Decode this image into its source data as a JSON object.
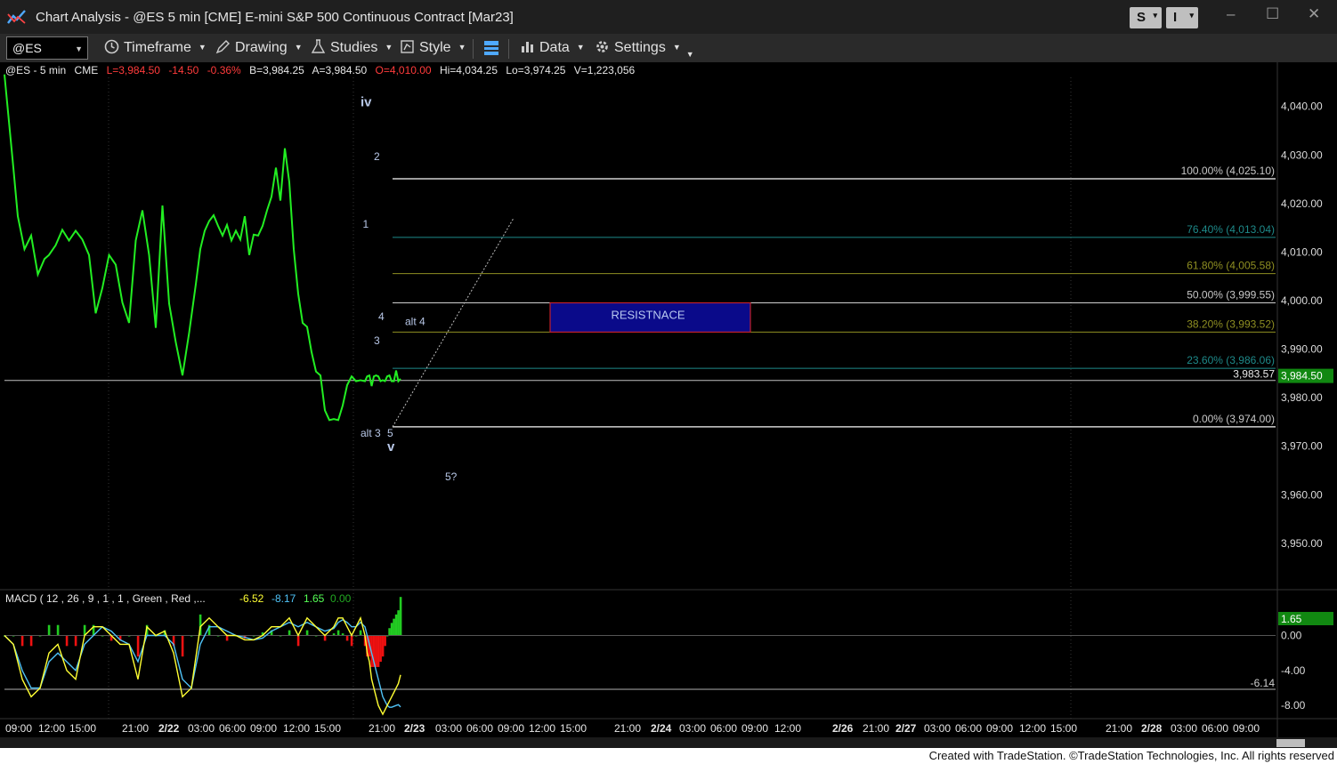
{
  "window": {
    "title": "Chart Analysis - @ES 5 min [CME] E-mini S&P 500 Continuous Contract [Mar23]",
    "btn_s": "S",
    "btn_i": "I",
    "minimize": "–",
    "maximize": "☐",
    "close": "✕"
  },
  "toolbar": {
    "symbol": "@ES",
    "timeframe": "Timeframe",
    "drawing": "Drawing",
    "studies": "Studies",
    "style": "Style",
    "data": "Data",
    "settings": "Settings"
  },
  "quote": {
    "symbol": "@ES - 5 min",
    "exchange": "CME",
    "last": "L=3,984.50",
    "change": "-14.50",
    "pct": "-0.36%",
    "bid": "B=3,984.25",
    "ask": "A=3,984.50",
    "open": "O=4,010.00",
    "high": "Hi=4,034.25",
    "low": "Lo=3,974.25",
    "volume": "V=1,223,056"
  },
  "colors": {
    "price": "#22ee22",
    "up": "#22cc22",
    "down": "#ee1111",
    "macd": "#4fc3f7",
    "signal": "#ffff33",
    "fib_white": "#d0d0d0",
    "fib_teal": "#1e8a8a",
    "fib_olive": "#8f8f22",
    "resistance_fill": "#0a0a8a",
    "resistance_border": "#c0202a",
    "label": "#b8c8e8",
    "last_price_bg": "#118811"
  },
  "chart_data": {
    "type": "line",
    "title": "",
    "xlabel": "",
    "ylabel": "",
    "ylim": [
      3941,
      4046
    ],
    "x_ticks": [
      "09:00",
      "12:00",
      "15:00",
      "21:00",
      "2/22",
      "03:00",
      "06:00",
      "09:00",
      "12:00",
      "15:00",
      "21:00",
      "2/23",
      "03:00",
      "06:00",
      "09:00",
      "12:00",
      "15:00",
      "21:00",
      "2/24",
      "03:00",
      "06:00",
      "09:00",
      "12:00",
      "2/26",
      "21:00",
      "2/27",
      "03:00",
      "06:00",
      "09:00",
      "12:00",
      "15:00",
      "21:00",
      "2/28",
      "03:00",
      "06:00",
      "09:00"
    ],
    "y_ticks": [
      "4,040.00",
      "4,030.00",
      "4,020.00",
      "4,010.00",
      "4,000.00",
      "3,990.00",
      "3,980.00",
      "3,970.00",
      "3,960.00",
      "3,950.00"
    ],
    "price_series": {
      "index": [
        0,
        4,
        6,
        9,
        12,
        15,
        18,
        20,
        23,
        26,
        29,
        32,
        35,
        38,
        41,
        44,
        47,
        50,
        53,
        56,
        59,
        62,
        65,
        68,
        71,
        74,
        77,
        80,
        83,
        86,
        88,
        90,
        92,
        94,
        96,
        98,
        100,
        102,
        104,
        106,
        108,
        110,
        112,
        114,
        116,
        118,
        120,
        122,
        124,
        126,
        128,
        130,
        132,
        134,
        136,
        138,
        140,
        142,
        144,
        146,
        148,
        150,
        152,
        154,
        156,
        158,
        160,
        162,
        163,
        164,
        165,
        166,
        167,
        168,
        169,
        170,
        171,
        172,
        173,
        174,
        175,
        176,
        177,
        178
      ],
      "close": [
        4046,
        4028,
        4018,
        4010,
        4014,
        4006,
        4008,
        4010,
        4012,
        4014,
        4013,
        4015,
        4012,
        4010,
        3998,
        4002,
        4010,
        4008,
        3999,
        3996,
        4013,
        4018,
        4010,
        3995,
        4019,
        4000,
        3992,
        3984,
        3994,
        4004,
        4010,
        4015,
        4017,
        4017,
        4016,
        4014,
        4015,
        4013,
        4015,
        4012,
        4018,
        4010,
        4013,
        4014,
        4016,
        4018,
        4022,
        4028,
        4020,
        4032,
        4025,
        4010,
        4002,
        3996,
        3994,
        3990,
        3986,
        3984,
        3978,
        3976,
        3975,
        3976,
        3979,
        3982,
        3985,
        3984,
        3983,
        3984,
        3985,
        3984,
        3983,
        3985,
        3984,
        3985,
        3984,
        3983,
        3984,
        3985,
        3984,
        3984,
        3984,
        3985,
        3984,
        3984.5
      ]
    },
    "fib_levels": [
      {
        "label": "100.00% (4,025.10)",
        "value": 4025.1
      },
      {
        "label": "76.40% (4,013.04)",
        "value": 4013.04
      },
      {
        "label": "61.80% (4,005.58)",
        "value": 4005.58
      },
      {
        "label": "50.00% (3,999.55)",
        "value": 3999.55
      },
      {
        "label": "38.20% (3,993.52)",
        "value": 3993.52
      },
      {
        "label": "23.60% (3,986.06)",
        "value": 3986.06
      },
      {
        "label": "0.00% (3,974.00)",
        "value": 3974.0
      }
    ],
    "horizontal_line": {
      "label": "3,983.57",
      "value": 3983.57
    },
    "last_price": {
      "label": "3,984.50",
      "value": 3984.5
    },
    "resistance_box": {
      "label": "RESISTNACE",
      "top": 3999.55,
      "bottom": 3993.52
    },
    "wave_labels": [
      {
        "text": "iv",
        "x": 160,
        "y": 4040
      },
      {
        "text": "2",
        "x": 166,
        "y": 4029
      },
      {
        "text": "1",
        "x": 161,
        "y": 4015
      },
      {
        "text": "4",
        "x": 168,
        "y": 3996
      },
      {
        "text": "alt 4",
        "x": 180,
        "y": 3995
      },
      {
        "text": "3",
        "x": 166,
        "y": 3991
      },
      {
        "text": "alt 3",
        "x": 160,
        "y": 3972
      },
      {
        "text": "5",
        "x": 172,
        "y": 3972
      },
      {
        "text": "v",
        "x": 172,
        "y": 3969
      },
      {
        "text": "5?",
        "x": 198,
        "y": 3963
      }
    ],
    "macd": {
      "header": "MACD ( 12 , 26 , 9 , 1 , 1 , Green , Red ,...",
      "macd_value": "-6.52",
      "signal_value": "-8.17",
      "hist_value": "1.65",
      "zero_value": "0.00",
      "ylim": [
        -9.5,
        3
      ],
      "y_ticks": [
        "0.00",
        "-4.00",
        "-8.00"
      ],
      "last_label": "1.65",
      "hline_label": "-6.14",
      "hline_value": -6.14,
      "index": [
        0,
        4,
        8,
        12,
        16,
        20,
        24,
        28,
        32,
        36,
        40,
        44,
        48,
        52,
        56,
        60,
        64,
        68,
        72,
        76,
        80,
        84,
        88,
        92,
        96,
        100,
        104,
        108,
        112,
        116,
        120,
        124,
        128,
        132,
        136,
        140,
        144,
        148,
        150,
        152,
        154,
        156,
        158,
        160,
        162,
        163,
        164,
        165,
        166,
        167,
        168,
        169,
        170,
        171,
        172,
        173,
        174,
        175,
        176,
        177,
        178
      ],
      "macd_line": [
        0,
        -1,
        -5,
        -7,
        -6,
        -2,
        -1,
        -4,
        -5,
        0,
        1,
        1,
        0,
        -1,
        -1,
        -5,
        1,
        0,
        0.5,
        -2,
        -7,
        -6,
        1,
        2,
        1,
        0,
        0,
        -0.5,
        -0.5,
        0,
        1,
        1,
        2,
        0,
        2,
        1,
        0,
        1,
        2,
        2,
        1,
        0,
        1,
        2,
        0,
        -2,
        -3,
        -5,
        -6,
        -7,
        -8,
        -8.5,
        -9,
        -8.5,
        -8,
        -7.5,
        -7,
        -6.5,
        -6,
        -5.5,
        -4.5
      ],
      "signal_line": [
        0,
        -1,
        -4,
        -6,
        -6,
        -3,
        -2,
        -3,
        -4,
        -1,
        0,
        1,
        0.5,
        -0.5,
        -1,
        -3,
        0,
        0,
        0,
        -1,
        -5,
        -6,
        -1,
        1,
        1,
        0.5,
        0,
        -0.2,
        -0.5,
        -0.3,
        0.5,
        1,
        1.5,
        1,
        1.5,
        1,
        0.5,
        0.8,
        1.5,
        1.8,
        1.5,
        1,
        1,
        1.5,
        1,
        0,
        -1,
        -2,
        -3,
        -4,
        -5,
        -6,
        -7,
        -7.5,
        -8,
        -8.2,
        -8.2,
        -8.1,
        -8.0,
        -7.9,
        -8.17
      ]
    }
  },
  "footer": {
    "credit": "Created with TradeStation. ©TradeStation Technologies, Inc. All rights reserved"
  }
}
